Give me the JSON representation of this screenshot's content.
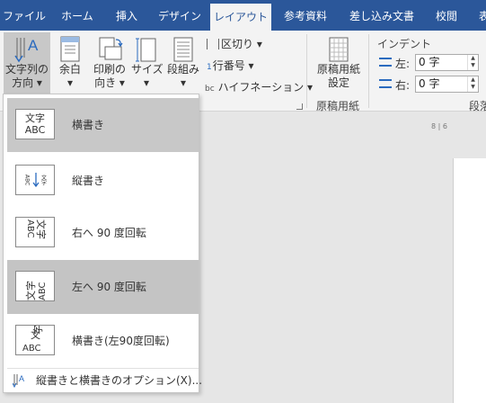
{
  "tabs": [
    {
      "label": "ファイル",
      "active": false
    },
    {
      "label": "ホーム",
      "active": false
    },
    {
      "label": "挿入",
      "active": false
    },
    {
      "label": "デザイン",
      "active": false
    },
    {
      "label": "レイアウト",
      "active": true
    },
    {
      "label": "参考資料",
      "active": false
    },
    {
      "label": "差し込み文書",
      "active": false
    },
    {
      "label": "校閲",
      "active": false
    },
    {
      "label": "表",
      "active": false
    }
  ],
  "ribbon": {
    "text_direction": {
      "line1": "文字列の",
      "line2": "方向 ▾"
    },
    "margins": {
      "line1": "余白",
      "line2": "▾"
    },
    "orientation": {
      "line1": "印刷の",
      "line2": "向き ▾"
    },
    "size": {
      "line1": "サイズ",
      "line2": "▾"
    },
    "columns": {
      "line1": "段組み",
      "line2": "▾"
    },
    "breaks": "区切り ▾",
    "line_numbers": "行番号 ▾",
    "hyphenation": "ハイフネーション ▾",
    "manuscript": {
      "line1": "原稿用紙",
      "line2": "設定",
      "group_label": "原稿用紙"
    },
    "indent": {
      "title": "インデント",
      "left_label": "左:",
      "left_value": "0 字",
      "right_label": "右:",
      "right_value": "0 字"
    },
    "paragraph_group_label": "段落"
  },
  "ruler_text": "8 | 6",
  "menu": {
    "items": [
      {
        "label": "横書き",
        "thumb": "文字\nABC",
        "state": "pressed"
      },
      {
        "label": "縦書き",
        "thumb": "",
        "state": "normal"
      },
      {
        "label": "右へ 90 度回転",
        "thumb": "文字\nABC",
        "state": "normal"
      },
      {
        "label": "左へ 90 度回転",
        "thumb": "文字\nABC",
        "state": "selected"
      },
      {
        "label": "横書き(左90度回転)",
        "thumb": "文字\nABC",
        "state": "normal"
      }
    ],
    "footer": "縦書きと横書きのオプション(X)..."
  },
  "colors": {
    "tab_bar": "#2b579a",
    "ribbon_bg": "#f3f3f3",
    "selected_item": "#c4c4c4",
    "icon_blue": "#2b6bbf"
  },
  "icons": [
    "text-direction-icon",
    "margins-icon",
    "orientation-icon",
    "size-icon",
    "columns-icon",
    "breaks-icon",
    "line-numbers-icon",
    "hyphenation-icon",
    "manuscript-icon",
    "indent-left-icon",
    "indent-right-icon",
    "dialog-launcher-icon"
  ]
}
